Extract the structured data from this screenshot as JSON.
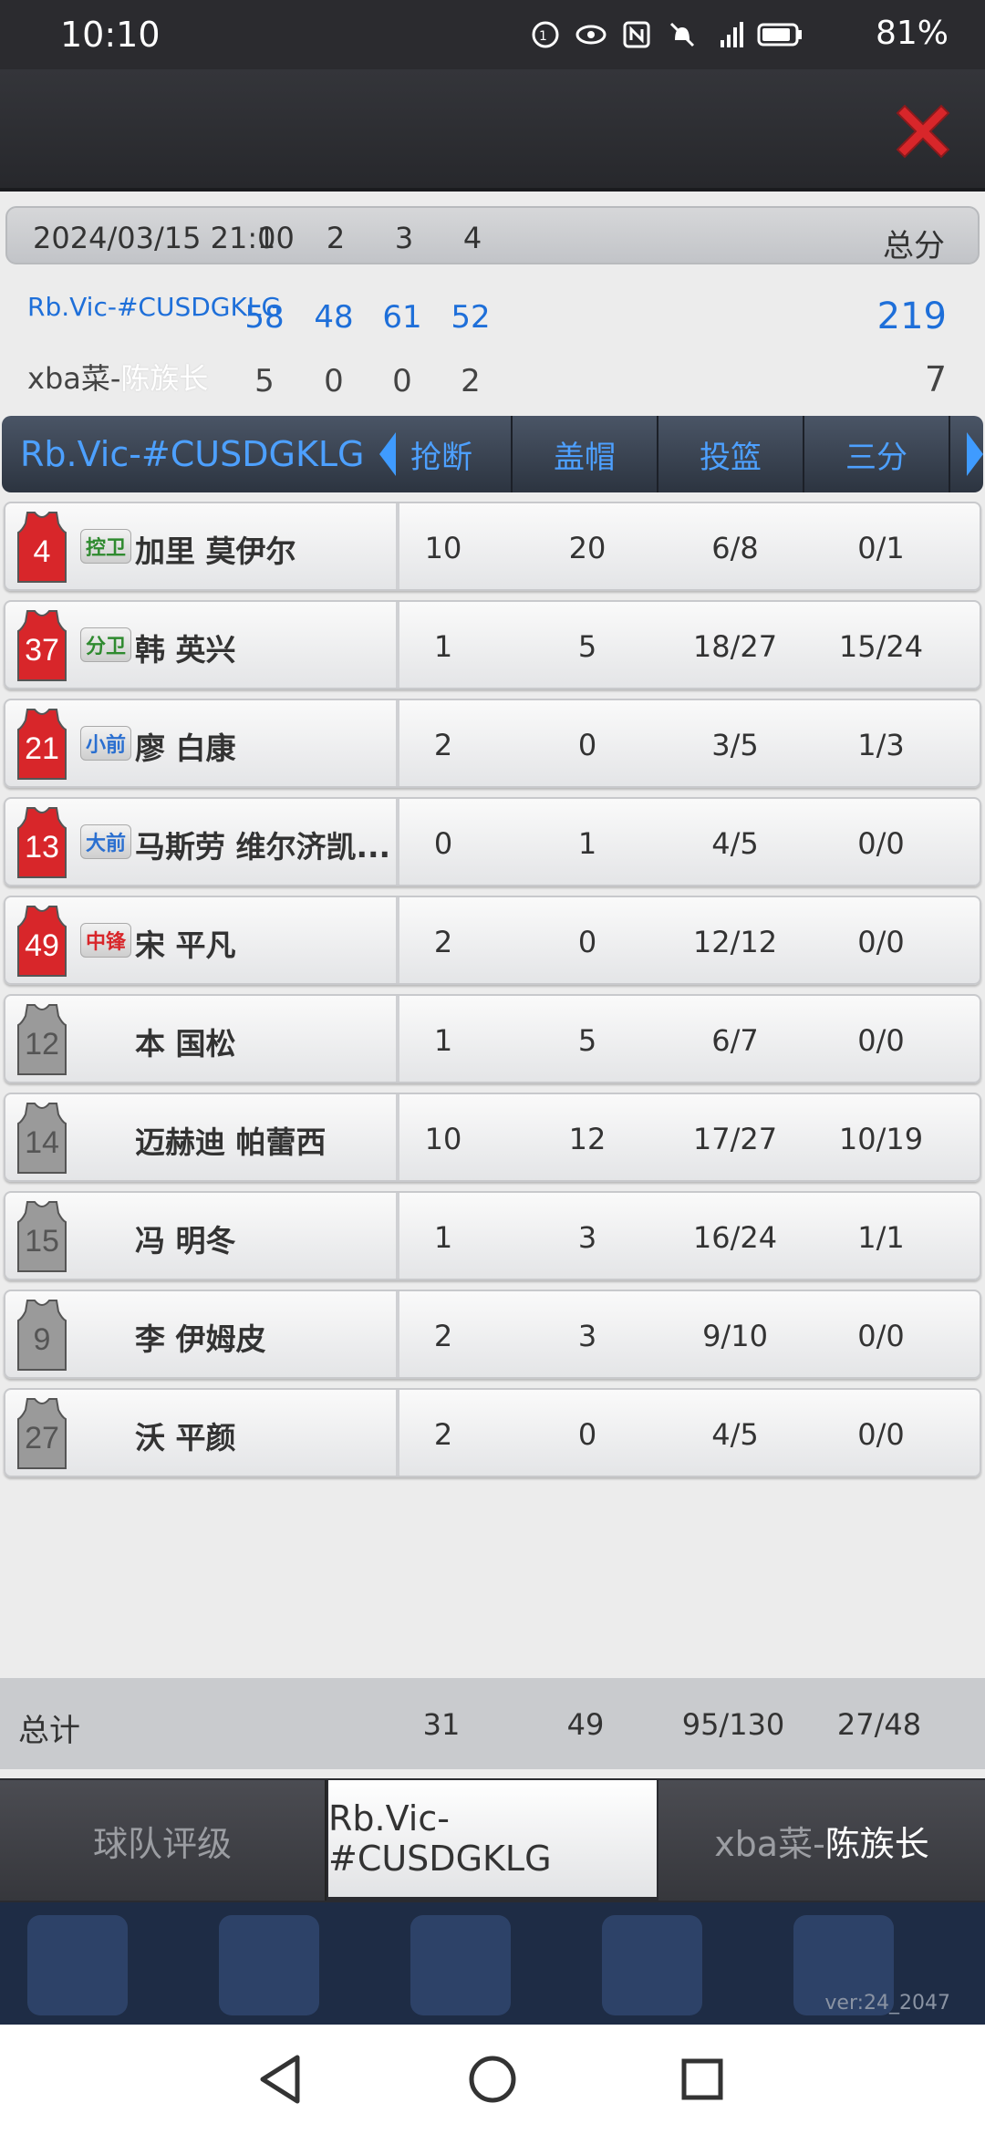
{
  "status_bar": {
    "time": "10:10",
    "battery": "81%"
  },
  "game": {
    "datetime": "2024/03/15 21:00",
    "quarters": [
      "1",
      "2",
      "3",
      "4"
    ],
    "total_label": "总分",
    "home": {
      "name": "Rb.Vic-#CUSDGKLG",
      "scores": [
        "58",
        "48",
        "61",
        "52"
      ],
      "total": "219"
    },
    "away": {
      "name_prefix": "xba菜-",
      "name_suffix": "陈族长",
      "scores": [
        "5",
        "0",
        "0",
        "2"
      ],
      "total": "7"
    }
  },
  "stats_header": {
    "team": "Rb.Vic-#CUSDGKLG",
    "columns": [
      "抢断",
      "盖帽",
      "投篮",
      "三分"
    ]
  },
  "players": [
    {
      "number": "4",
      "position": "控卫",
      "name": "加里 莫伊尔",
      "steals": "10",
      "blocks": "20",
      "fg": "6/8",
      "three": "0/1"
    },
    {
      "number": "37",
      "position": "分卫",
      "name": "韩 英兴",
      "steals": "1",
      "blocks": "5",
      "fg": "18/27",
      "three": "15/24"
    },
    {
      "number": "21",
      "position": "小前",
      "name": "廖 白康",
      "steals": "2",
      "blocks": "0",
      "fg": "3/5",
      "three": "1/3"
    },
    {
      "number": "13",
      "position": "大前",
      "name": "马斯劳 维尔济凯...",
      "steals": "0",
      "blocks": "1",
      "fg": "4/5",
      "three": "0/0"
    },
    {
      "number": "49",
      "position": "中锋",
      "name": "宋 平凡",
      "steals": "2",
      "blocks": "0",
      "fg": "12/12",
      "three": "0/0"
    },
    {
      "number": "12",
      "position": "",
      "name": "本 国松",
      "steals": "1",
      "blocks": "5",
      "fg": "6/7",
      "three": "0/0"
    },
    {
      "number": "14",
      "position": "",
      "name": "迈赫迪 帕蕾西",
      "steals": "10",
      "blocks": "12",
      "fg": "17/27",
      "three": "10/19"
    },
    {
      "number": "15",
      "position": "",
      "name": "冯 明冬",
      "steals": "1",
      "blocks": "3",
      "fg": "16/24",
      "three": "1/1"
    },
    {
      "number": "9",
      "position": "",
      "name": "李 伊姆皮",
      "steals": "2",
      "blocks": "3",
      "fg": "9/10",
      "three": "0/0"
    },
    {
      "number": "27",
      "position": "",
      "name": "沃 平颜",
      "steals": "2",
      "blocks": "0",
      "fg": "4/5",
      "three": "0/0"
    }
  ],
  "totals": {
    "label": "总计",
    "steals": "31",
    "blocks": "49",
    "fg": "95/130",
    "three": "27/48"
  },
  "tabs": {
    "rating": "球队评级",
    "home": "Rb.Vic-#CUSDGKLG",
    "away_prefix": "xba菜-",
    "away_suffix": "陈族长"
  },
  "version": "ver:24_2047",
  "colors": {
    "accent_blue": "#1e6fd9",
    "header_blue": "#4da0ff",
    "starter_jersey": "#d8262a",
    "bench_jersey": "#9a9a9a",
    "close_red": "#d8262a"
  }
}
